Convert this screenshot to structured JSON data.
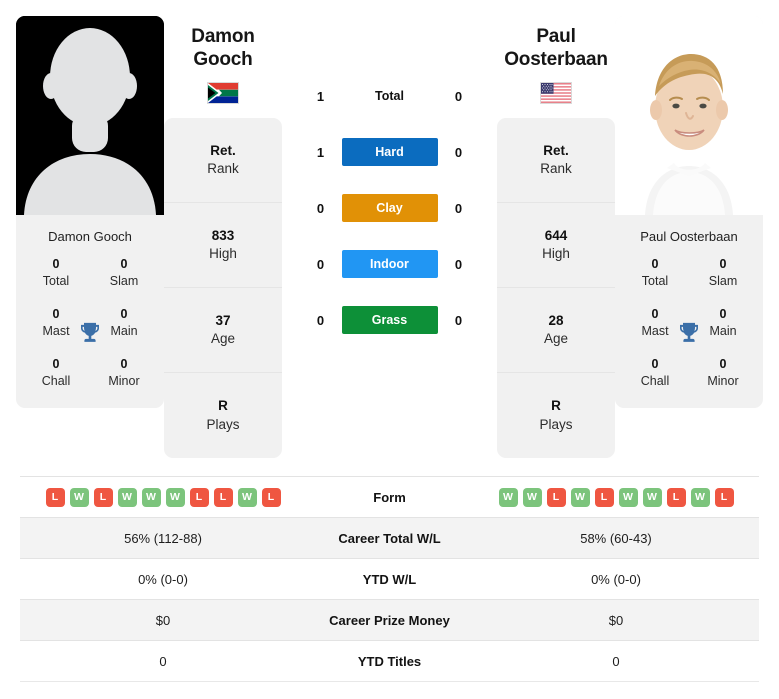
{
  "colors": {
    "hard": "#0b6cbf",
    "clay": "#e19106",
    "indoor": "#2196f3",
    "grass": "#0d9038",
    "win": "#7cc47c",
    "loss": "#ef5641",
    "trophy": "#3b6fa8"
  },
  "left_player": {
    "first_name": "Damon",
    "last_name": "Gooch",
    "full_name": "Damon Gooch",
    "country": "South Africa",
    "flag_icon": "flag-south-africa",
    "photo_type": "silhouette-placeholder",
    "titles": [
      {
        "value": "0",
        "label": "Total"
      },
      {
        "value": "0",
        "label": "Slam"
      },
      {
        "value": "0",
        "label": "Mast"
      },
      {
        "value": "0",
        "label": "Main"
      },
      {
        "value": "0",
        "label": "Chall"
      },
      {
        "value": "0",
        "label": "Minor"
      }
    ],
    "stats": [
      {
        "value": "Ret.",
        "label": "Rank"
      },
      {
        "value": "833",
        "label": "High"
      },
      {
        "value": "37",
        "label": "Age"
      },
      {
        "value": "R",
        "label": "Plays"
      }
    ],
    "surface_wins": {
      "total": "1",
      "hard": "1",
      "clay": "0",
      "indoor": "0",
      "grass": "0"
    },
    "form": [
      "L",
      "W",
      "L",
      "W",
      "W",
      "W",
      "L",
      "L",
      "W",
      "L"
    ],
    "career_total_wl": "56% (112-88)",
    "ytd_wl": "0% (0-0)",
    "career_prize_money": "$0",
    "ytd_titles": "0"
  },
  "right_player": {
    "first_name": "Paul",
    "last_name": "Oosterbaan",
    "full_name": "Paul Oosterbaan",
    "country": "United States",
    "flag_icon": "flag-united-states",
    "photo_type": "headshot",
    "titles": [
      {
        "value": "0",
        "label": "Total"
      },
      {
        "value": "0",
        "label": "Slam"
      },
      {
        "value": "0",
        "label": "Mast"
      },
      {
        "value": "0",
        "label": "Main"
      },
      {
        "value": "0",
        "label": "Chall"
      },
      {
        "value": "0",
        "label": "Minor"
      }
    ],
    "stats": [
      {
        "value": "Ret.",
        "label": "Rank"
      },
      {
        "value": "644",
        "label": "High"
      },
      {
        "value": "28",
        "label": "Age"
      },
      {
        "value": "R",
        "label": "Plays"
      }
    ],
    "surface_wins": {
      "total": "0",
      "hard": "0",
      "clay": "0",
      "indoor": "0",
      "grass": "0"
    },
    "form": [
      "W",
      "W",
      "L",
      "W",
      "L",
      "W",
      "W",
      "L",
      "W",
      "L"
    ],
    "career_total_wl": "58% (60-43)",
    "ytd_wl": "0% (0-0)",
    "career_prize_money": "$0",
    "ytd_titles": "0"
  },
  "surfaces": [
    {
      "key": "total",
      "label": "Total",
      "styled": false
    },
    {
      "key": "hard",
      "label": "Hard",
      "styled": true
    },
    {
      "key": "clay",
      "label": "Clay",
      "styled": true
    },
    {
      "key": "indoor",
      "label": "Indoor",
      "styled": true
    },
    {
      "key": "grass",
      "label": "Grass",
      "styled": true
    }
  ],
  "table": {
    "rows": [
      {
        "label": "Form",
        "type": "form"
      },
      {
        "label": "Career Total W/L",
        "type": "text",
        "left": "56% (112-88)",
        "right": "58% (60-43)"
      },
      {
        "label": "YTD W/L",
        "type": "text",
        "left": "0% (0-0)",
        "right": "0% (0-0)"
      },
      {
        "label": "Career Prize Money",
        "type": "text",
        "left": "$0",
        "right": "$0"
      },
      {
        "label": "YTD Titles",
        "type": "text",
        "left": "0",
        "right": "0"
      }
    ]
  }
}
